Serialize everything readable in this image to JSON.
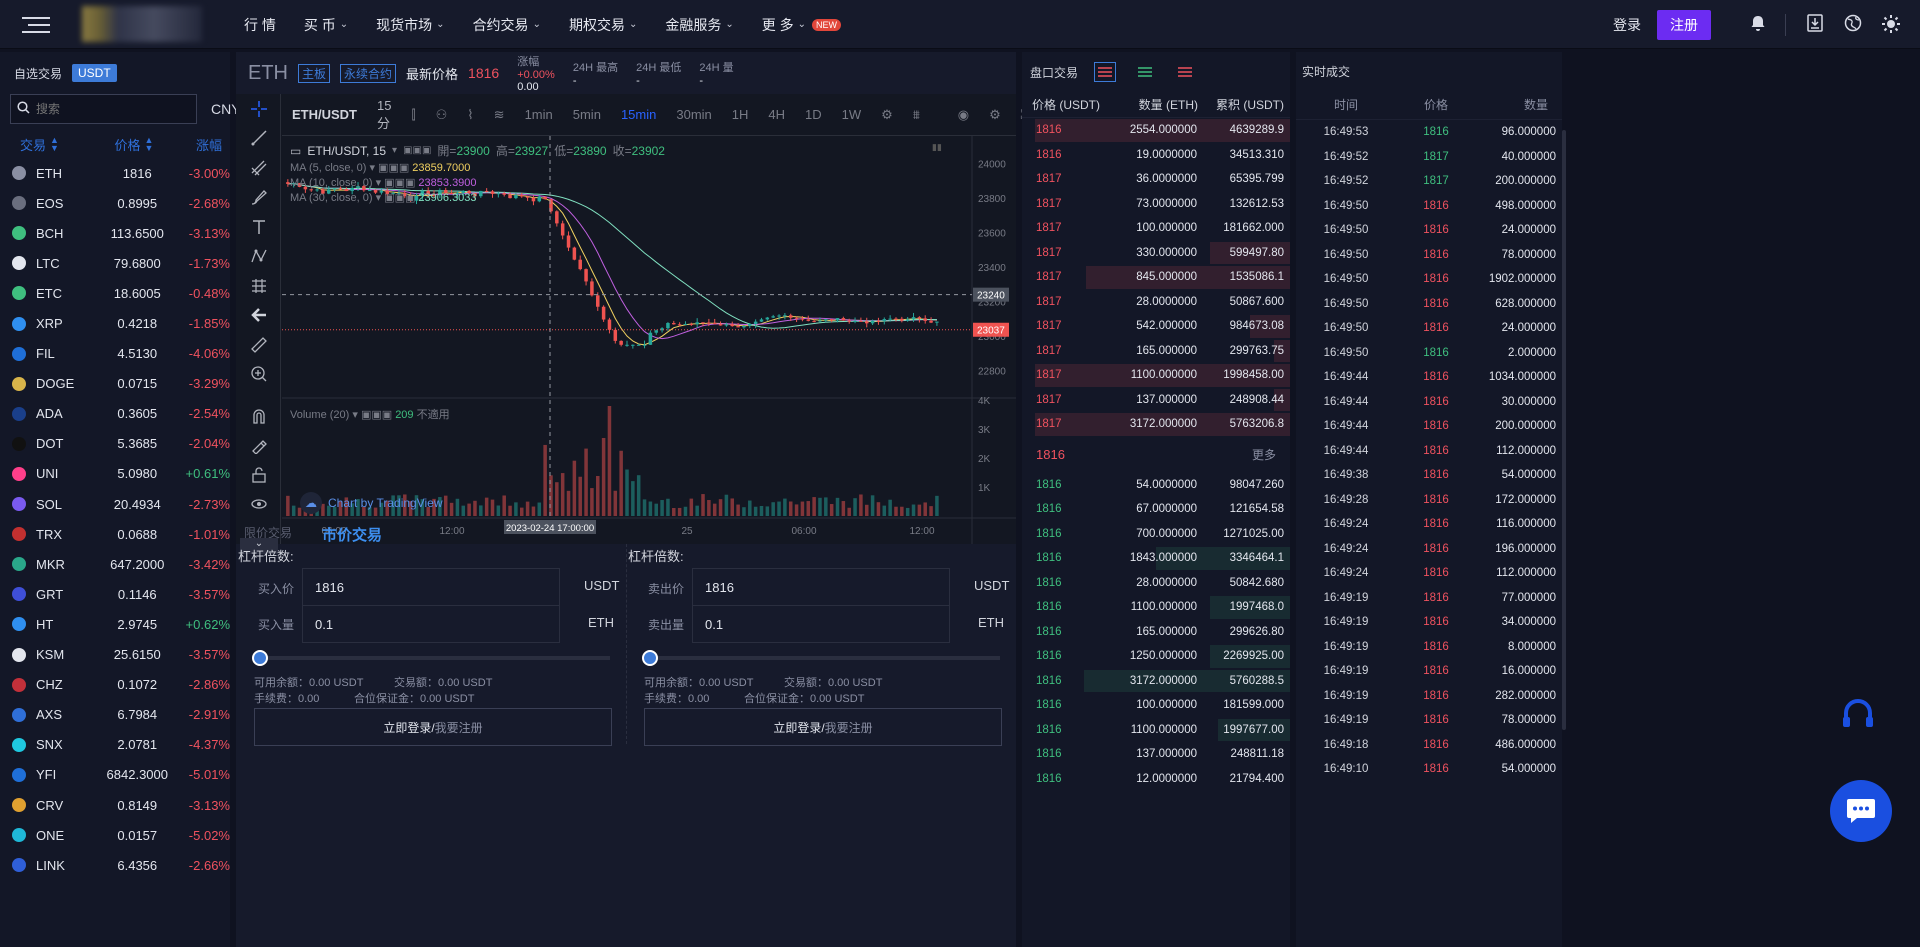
{
  "nav": {
    "items": [
      {
        "label": "行 情",
        "chev": false
      },
      {
        "label": "买 币",
        "chev": true
      },
      {
        "label": "现货市场",
        "chev": true
      },
      {
        "label": "合约交易",
        "chev": true
      },
      {
        "label": "期权交易",
        "chev": true
      },
      {
        "label": "金融服务",
        "chev": true
      },
      {
        "label": "更 多",
        "chev": true
      }
    ],
    "new_badge": "NEW",
    "login": "登录",
    "register": "注册"
  },
  "left": {
    "tab_fav": "自选交易",
    "tab_usdt": "USDT",
    "search_placeholder": "搜索",
    "currency": "CNY",
    "col_trade": "交易",
    "col_price": "价格",
    "col_change": "涨幅",
    "coins": [
      {
        "name": "ETH",
        "price": "1816",
        "change": "-3.00%",
        "color": "#8a8fa3"
      },
      {
        "name": "EOS",
        "price": "0.8995",
        "change": "-2.68%",
        "color": "#6a6e7e"
      },
      {
        "name": "BCH",
        "price": "113.6500",
        "change": "-3.13%",
        "color": "#3fbf7f"
      },
      {
        "name": "LTC",
        "price": "79.6800",
        "change": "-1.73%",
        "color": "#e3e6ee"
      },
      {
        "name": "ETC",
        "price": "18.6005",
        "change": "-0.48%",
        "color": "#3fbf7f"
      },
      {
        "name": "XRP",
        "price": "0.4218",
        "change": "-1.85%",
        "color": "#2f8ff0"
      },
      {
        "name": "FIL",
        "price": "4.5130",
        "change": "-4.06%",
        "color": "#1f6fd8"
      },
      {
        "name": "DOGE",
        "price": "0.0715",
        "change": "-3.29%",
        "color": "#d8b44a"
      },
      {
        "name": "ADA",
        "price": "0.3605",
        "change": "-2.54%",
        "color": "#1a3f8a"
      },
      {
        "name": "DOT",
        "price": "5.3685",
        "change": "-2.04%",
        "color": "#111"
      },
      {
        "name": "UNI",
        "price": "5.0980",
        "change": "+0.61%",
        "color": "#ff3f8a"
      },
      {
        "name": "SOL",
        "price": "20.4934",
        "change": "-2.73%",
        "color": "#7a5af0"
      },
      {
        "name": "TRX",
        "price": "0.0688",
        "change": "-1.01%",
        "color": "#c23030"
      },
      {
        "name": "MKR",
        "price": "647.2000",
        "change": "-3.42%",
        "color": "#2aa88a"
      },
      {
        "name": "GRT",
        "price": "0.1146",
        "change": "-3.57%",
        "color": "#3f4fd8"
      },
      {
        "name": "HT",
        "price": "2.9745",
        "change": "+0.62%",
        "color": "#2f8ff0"
      },
      {
        "name": "KSM",
        "price": "25.6150",
        "change": "-3.57%",
        "color": "#e3e6ee"
      },
      {
        "name": "CHZ",
        "price": "0.1072",
        "change": "-2.86%",
        "color": "#c2303a"
      },
      {
        "name": "AXS",
        "price": "6.7984",
        "change": "-2.91%",
        "color": "#2f6fd8"
      },
      {
        "name": "SNX",
        "price": "2.0781",
        "change": "-4.37%",
        "color": "#1fc8e0"
      },
      {
        "name": "YFI",
        "price": "6842.3000",
        "change": "-5.01%",
        "color": "#1f6fd8"
      },
      {
        "name": "CRV",
        "price": "0.8149",
        "change": "-3.13%",
        "color": "#e0a030"
      },
      {
        "name": "ONE",
        "price": "0.0157",
        "change": "-5.02%",
        "color": "#1fb8d8"
      },
      {
        "name": "LINK",
        "price": "6.4356",
        "change": "-2.66%",
        "color": "#2f5fd8"
      }
    ]
  },
  "ticker": {
    "symbol": "ETH",
    "tag_main": "主板",
    "tag_perp": "永续合约",
    "last_label": "最新价格",
    "last_price": "1816",
    "chg_label": "涨幅",
    "chg_pct": "+0.00%",
    "chg_val": "0.00",
    "high_label": "24H 最高",
    "high_val": "-",
    "low_label": "24H 最低",
    "low_val": "-",
    "vol_label": "24H 量",
    "vol_val": "-"
  },
  "chart": {
    "symbol": "ETH/USDT",
    "interval": "15分",
    "timeframes": [
      "1min",
      "5min",
      "15min",
      "30min",
      "1H",
      "4H",
      "1D",
      "1W"
    ],
    "active_tf": "15min",
    "legend_title": "ETH/USDT, 15",
    "ohlc": {
      "o_label": "開=",
      "o": "23900",
      "h_label": "高=",
      "h": "23927",
      "l_label": "低=",
      "l": "23890",
      "c_label": "收=",
      "c": "23902"
    },
    "ma1": {
      "label": "MA (5, close, 0)",
      "value": "23859.7000",
      "color": "#f0d060"
    },
    "ma2": {
      "label": "MA (10, close, 0)",
      "value": "23853.3900",
      "color": "#c060e0"
    },
    "ma3": {
      "label": "MA (30, close, 0)",
      "value": "23906.3033",
      "color": "#80e0c0"
    },
    "volume_label": "Volume (20)",
    "volume_value": "209",
    "volume_na": "不適用",
    "watermark": "Chart by TradingView",
    "price_axis": [
      "24000",
      "23800",
      "23600",
      "23400",
      "23200",
      "23000",
      "22800"
    ],
    "vol_axis": [
      "4K",
      "3K",
      "2K",
      "1K"
    ],
    "time_axis": [
      "06:00",
      "12:00",
      "25",
      "06:00",
      "12:00"
    ],
    "crosshair_time": "2023-02-24 17:00:00",
    "crosshair_price": "23240",
    "last_price_tag": "23037"
  },
  "trade": {
    "mode_limit": "限价交易",
    "mode_market": "市价交易",
    "lev_label": "杠杆倍数:",
    "buy_price_label": "买入价",
    "buy_qty_label": "买入量",
    "sell_price_label": "卖出价",
    "sell_qty_label": "卖出量",
    "price_value": "1816",
    "qty_value": "0.1",
    "unit_usdt": "USDT",
    "unit_eth": "ETH",
    "avail": "可用余额：0.00 USDT",
    "amount": "交易额：0.00 USDT",
    "fee": "手续费：0.00",
    "margin": "合位保证金：0.00 USDT",
    "login_btn": "立即登录/",
    "register_link": "我要注册"
  },
  "book": {
    "title": "盘口交易",
    "col_price": "价格 (USDT)",
    "col_qty": "数量 (ETH)",
    "col_total": "累积 (USDT)",
    "asks": [
      {
        "p": "1816",
        "q": "2554.000000",
        "t": "4639289.9",
        "w": 0.95
      },
      {
        "p": "1816",
        "q": "19.0000000",
        "t": "34513.310",
        "w": 0.0
      },
      {
        "p": "1817",
        "q": "36.0000000",
        "t": "65395.799",
        "w": 0.0
      },
      {
        "p": "1817",
        "q": "73.0000000",
        "t": "132612.53",
        "w": 0.0
      },
      {
        "p": "1817",
        "q": "100.000000",
        "t": "181662.000",
        "w": 0.0
      },
      {
        "p": "1817",
        "q": "330.000000",
        "t": "599497.80",
        "w": 0.3
      },
      {
        "p": "1817",
        "q": "845.000000",
        "t": "1535086.1",
        "w": 0.76
      },
      {
        "p": "1817",
        "q": "28.0000000",
        "t": "50867.600",
        "w": 0.0
      },
      {
        "p": "1817",
        "q": "542.000000",
        "t": "984673.08",
        "w": 0.15
      },
      {
        "p": "1817",
        "q": "165.000000",
        "t": "299763.75",
        "w": 0.06
      },
      {
        "p": "1817",
        "q": "1100.000000",
        "t": "1998458.00",
        "w": 0.95
      },
      {
        "p": "1817",
        "q": "137.000000",
        "t": "248908.44",
        "w": 0.06
      },
      {
        "p": "1817",
        "q": "3172.000000",
        "t": "5763206.8",
        "w": 0.95
      }
    ],
    "mid_price": "1816",
    "more": "更多",
    "bids": [
      {
        "p": "1816",
        "q": "54.0000000",
        "t": "98047.260",
        "w": 0.0
      },
      {
        "p": "1816",
        "q": "67.0000000",
        "t": "121654.58",
        "w": 0.0
      },
      {
        "p": "1816",
        "q": "700.000000",
        "t": "1271025.00",
        "w": 0.0
      },
      {
        "p": "1816",
        "q": "1843.000000",
        "t": "3346464.1",
        "w": 0.5
      },
      {
        "p": "1816",
        "q": "28.0000000",
        "t": "50842.680",
        "w": 0.0
      },
      {
        "p": "1816",
        "q": "1100.000000",
        "t": "1997468.0",
        "w": 0.3
      },
      {
        "p": "1816",
        "q": "165.000000",
        "t": "299626.80",
        "w": 0.0
      },
      {
        "p": "1816",
        "q": "1250.000000",
        "t": "2269925.00",
        "w": 0.3
      },
      {
        "p": "1816",
        "q": "3172.000000",
        "t": "5760288.5",
        "w": 0.77
      },
      {
        "p": "1816",
        "q": "100.000000",
        "t": "181599.000",
        "w": 0.0
      },
      {
        "p": "1816",
        "q": "1100.000000",
        "t": "1997677.00",
        "w": 0.27
      },
      {
        "p": "1816",
        "q": "137.000000",
        "t": "248811.18",
        "w": 0.0
      },
      {
        "p": "1816",
        "q": "12.0000000",
        "t": "21794.400",
        "w": 0.0
      }
    ]
  },
  "trades": {
    "title": "实时成交",
    "col_time": "时间",
    "col_price": "价格",
    "col_qty": "数量",
    "rows": [
      {
        "t": "16:49:53",
        "p": "1816",
        "q": "96.000000",
        "side": "up"
      },
      {
        "t": "16:49:52",
        "p": "1817",
        "q": "40.000000",
        "side": "up"
      },
      {
        "t": "16:49:52",
        "p": "1817",
        "q": "200.000000",
        "side": "up"
      },
      {
        "t": "16:49:50",
        "p": "1816",
        "q": "498.000000",
        "side": "down"
      },
      {
        "t": "16:49:50",
        "p": "1816",
        "q": "24.000000",
        "side": "down"
      },
      {
        "t": "16:49:50",
        "p": "1816",
        "q": "78.000000",
        "side": "down"
      },
      {
        "t": "16:49:50",
        "p": "1816",
        "q": "1902.000000",
        "side": "down"
      },
      {
        "t": "16:49:50",
        "p": "1816",
        "q": "628.000000",
        "side": "down"
      },
      {
        "t": "16:49:50",
        "p": "1816",
        "q": "24.000000",
        "side": "down"
      },
      {
        "t": "16:49:50",
        "p": "1816",
        "q": "2.000000",
        "side": "up"
      },
      {
        "t": "16:49:44",
        "p": "1816",
        "q": "1034.000000",
        "side": "down"
      },
      {
        "t": "16:49:44",
        "p": "1816",
        "q": "30.000000",
        "side": "down"
      },
      {
        "t": "16:49:44",
        "p": "1816",
        "q": "200.000000",
        "side": "down"
      },
      {
        "t": "16:49:44",
        "p": "1816",
        "q": "112.000000",
        "side": "down"
      },
      {
        "t": "16:49:38",
        "p": "1816",
        "q": "54.000000",
        "side": "down"
      },
      {
        "t": "16:49:28",
        "p": "1816",
        "q": "172.000000",
        "side": "down"
      },
      {
        "t": "16:49:24",
        "p": "1816",
        "q": "116.000000",
        "side": "down"
      },
      {
        "t": "16:49:24",
        "p": "1816",
        "q": "196.000000",
        "side": "down"
      },
      {
        "t": "16:49:24",
        "p": "1816",
        "q": "112.000000",
        "side": "down"
      },
      {
        "t": "16:49:19",
        "p": "1816",
        "q": "77.000000",
        "side": "down"
      },
      {
        "t": "16:49:19",
        "p": "1816",
        "q": "34.000000",
        "side": "down"
      },
      {
        "t": "16:49:19",
        "p": "1816",
        "q": "8.000000",
        "side": "down"
      },
      {
        "t": "16:49:19",
        "p": "1816",
        "q": "16.000000",
        "side": "down"
      },
      {
        "t": "16:49:19",
        "p": "1816",
        "q": "282.000000",
        "side": "down"
      },
      {
        "t": "16:49:19",
        "p": "1816",
        "q": "78.000000",
        "side": "down"
      },
      {
        "t": "16:49:18",
        "p": "1816",
        "q": "486.000000",
        "side": "down"
      },
      {
        "t": "16:49:10",
        "p": "1816",
        "q": "54.000000",
        "side": "down"
      }
    ]
  }
}
